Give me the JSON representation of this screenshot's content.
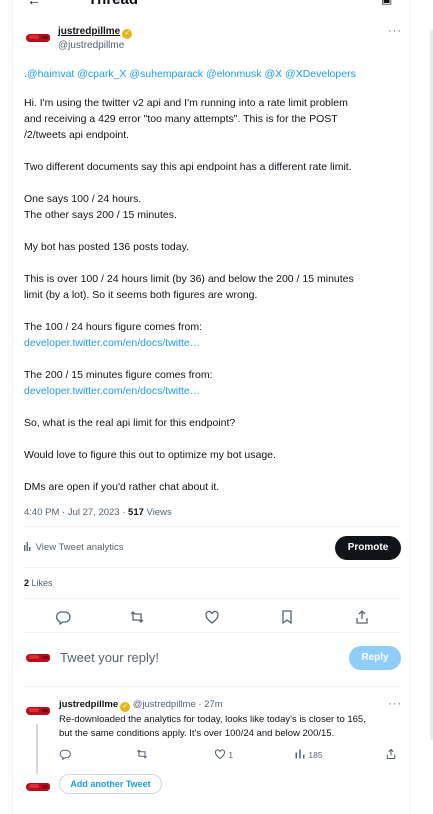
{
  "header": {
    "back_icon": "arrow-left-icon",
    "title": "Thread",
    "extra_icon": "bookmark-icon"
  },
  "tweet": {
    "author_name": "justredpillme",
    "author_handle": "@justredpillme",
    "more": "···",
    "mentions": ".@haimvat @cpark_X @suhemparack @elonmusk @X @XDevelopers",
    "lines": [
      "Hi. I'm using the twitter v2 api and I'm running into a rate limit problem",
      "and receiving a 429 error \"too many attempts\". This is for the POST",
      "/2/tweets api endpoint.",
      "Two different documents say this api endpoint has a different rate limit.",
      "One says 100 / 24 hours.",
      "The other says 200 / 15 minutes.",
      "My bot has posted 136 posts today.",
      "This is over 100 / 24 hours limit (by 36) and below the 200 / 15 minutes",
      "limit (by a lot). So it seems both figures are wrong.",
      "The 100 / 24 hours figure comes from:",
      "developer.twitter.com/en/docs/twitte…",
      "The 200 / 15 minutes figure comes from:",
      "developer.twitter.com/en/docs/twitte…",
      "So, what is the real api limit for this endpoint?",
      "Would love to figure this out to optimize my bot usage.",
      "DMs are open if you'd rather chat about it."
    ],
    "timestamp": "4:40 PM · Jul 27, 2023 · ",
    "views_count": "517",
    "views_label": " Views",
    "analytics_label": "View Tweet analytics",
    "promote_label": "Promote",
    "likes_count": "2",
    "likes_label": " Likes"
  },
  "actions": [
    "reply-icon",
    "retweet-icon",
    "like-icon",
    "bookmark-icon",
    "share-icon"
  ],
  "reply_box": {
    "placeholder": "Tweet your reply!",
    "button": "Reply"
  },
  "reply": {
    "author_name": "justredpillme",
    "meta": " @justredpillme · 27m",
    "more": "···",
    "lines": [
      "Re-downloaded the analytics for today, looks like today's is closer to 165,",
      "but the same conditions apply. It's over 100/24 and below 200/15."
    ],
    "likes": "1",
    "views": "185"
  },
  "add_tweet_label": "Add another Tweet",
  "colors": {
    "link": "#1d9bf0",
    "promote_bg": "#0f1419",
    "reply_disabled": "#8ecdf8",
    "verified": "#e2b719",
    "avatar": "#b40f1b"
  }
}
